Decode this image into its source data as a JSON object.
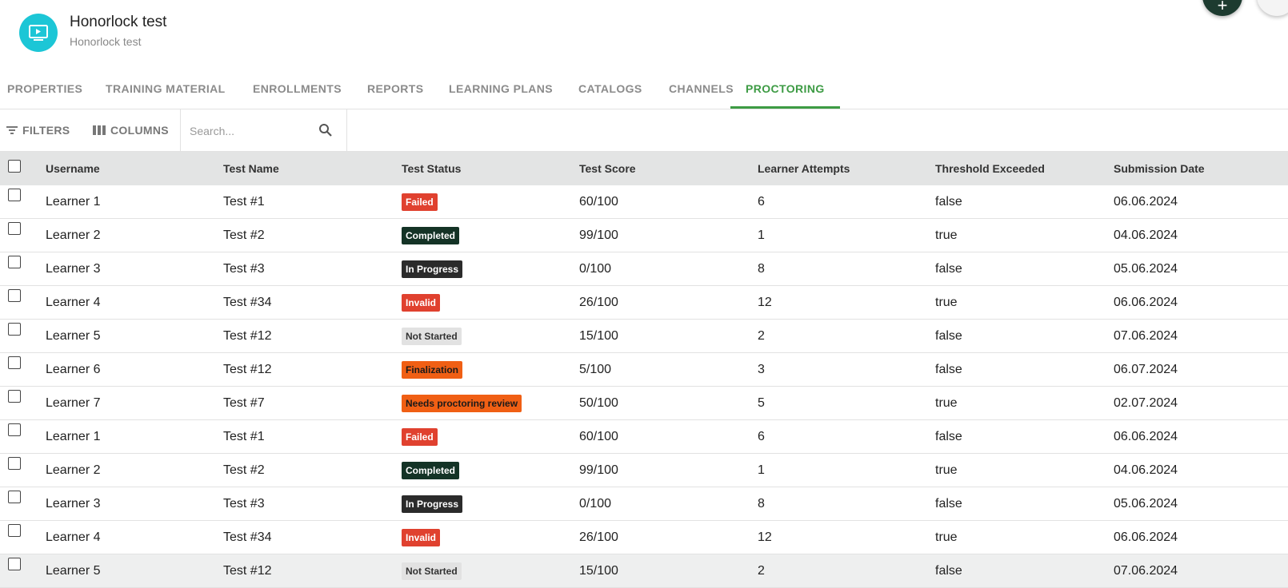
{
  "course": {
    "title": "Honorlock test",
    "subtitle": "Honorlock test"
  },
  "tabs": [
    {
      "label": "PROPERTIES"
    },
    {
      "label": "TRAINING MATERIAL"
    },
    {
      "label": "ENROLLMENTS"
    },
    {
      "label": "REPORTS"
    },
    {
      "label": "LEARNING PLANS"
    },
    {
      "label": "CATALOGS"
    },
    {
      "label": "CHANNELS"
    },
    {
      "label": "PROCTORING"
    }
  ],
  "active_tab": "PROCTORING",
  "toolbar": {
    "filters_label": "FILTERS",
    "columns_label": "COLUMNS",
    "search_placeholder": "Search..."
  },
  "columns": [
    "Username",
    "Test Name",
    "Test Status",
    "Test Score",
    "Learner Attempts",
    "Threshold Exceeded",
    "Submission Date"
  ],
  "status_colors": {
    "Failed": {
      "bg": "#e0412f",
      "fg": "#ffffff"
    },
    "Completed": {
      "bg": "#143326",
      "fg": "#ffffff"
    },
    "In Progress": {
      "bg": "#2b2b2b",
      "fg": "#ffffff"
    },
    "Invalid": {
      "bg": "#e0412f",
      "fg": "#ffffff"
    },
    "Not Started": {
      "bg": "#e2e2e2",
      "fg": "#333333"
    },
    "Finalization": {
      "bg": "#f05f14",
      "fg": "#1a1a1a"
    },
    "Needs proctoring review": {
      "bg": "#f05f14",
      "fg": "#1a1a1a"
    }
  },
  "rows": [
    {
      "username": "Learner 1",
      "test_name": "Test #1",
      "status": "Failed",
      "score": "60/100",
      "attempts": "6",
      "threshold": "false",
      "date": "06.06.2024"
    },
    {
      "username": "Learner 2",
      "test_name": "Test #2",
      "status": "Completed",
      "score": "99/100",
      "attempts": "1",
      "threshold": "true",
      "date": "04.06.2024"
    },
    {
      "username": "Learner 3",
      "test_name": "Test #3",
      "status": "In Progress",
      "score": "0/100",
      "attempts": "8",
      "threshold": "false",
      "date": "05.06.2024"
    },
    {
      "username": "Learner 4",
      "test_name": "Test #34",
      "status": "Invalid",
      "score": "26/100",
      "attempts": "12",
      "threshold": "true",
      "date": "06.06.2024"
    },
    {
      "username": "Learner 5",
      "test_name": "Test #12",
      "status": "Not Started",
      "score": "15/100",
      "attempts": "2",
      "threshold": "false",
      "date": "07.06.2024"
    },
    {
      "username": "Learner 6",
      "test_name": "Test #12",
      "status": "Finalization",
      "score": "5/100",
      "attempts": "3",
      "threshold": "false",
      "date": "06.07.2024"
    },
    {
      "username": "Learner 7",
      "test_name": "Test #7",
      "status": "Needs proctoring review",
      "score": "50/100",
      "attempts": "5",
      "threshold": "true",
      "date": "02.07.2024"
    },
    {
      "username": "Learner 1",
      "test_name": "Test #1",
      "status": "Failed",
      "score": "60/100",
      "attempts": "6",
      "threshold": "false",
      "date": "06.06.2024"
    },
    {
      "username": "Learner 2",
      "test_name": "Test #2",
      "status": "Completed",
      "score": "99/100",
      "attempts": "1",
      "threshold": "true",
      "date": "04.06.2024"
    },
    {
      "username": "Learner 3",
      "test_name": "Test #3",
      "status": "In Progress",
      "score": "0/100",
      "attempts": "8",
      "threshold": "false",
      "date": "05.06.2024"
    },
    {
      "username": "Learner 4",
      "test_name": "Test #34",
      "status": "Invalid",
      "score": "26/100",
      "attempts": "12",
      "threshold": "true",
      "date": "06.06.2024"
    },
    {
      "username": "Learner 5",
      "test_name": "Test #12",
      "status": "Not Started",
      "score": "15/100",
      "attempts": "2",
      "threshold": "false",
      "date": "07.06.2024"
    }
  ]
}
